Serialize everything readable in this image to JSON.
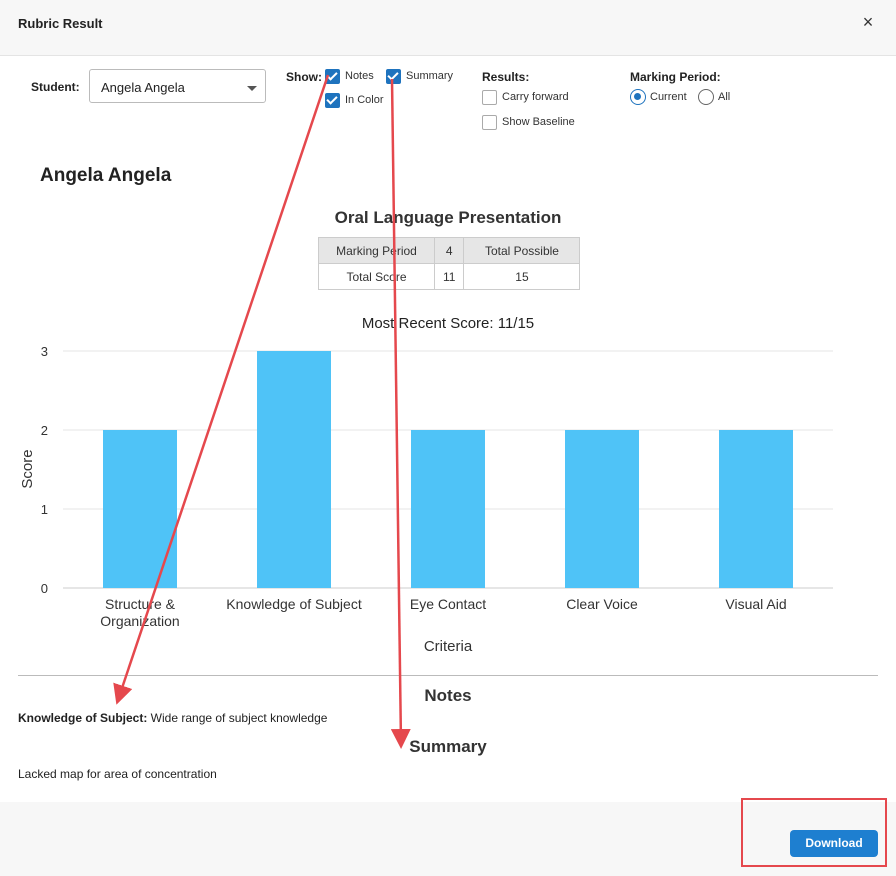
{
  "dialog": {
    "title": "Rubric Result",
    "close_label": "×"
  },
  "filters": {
    "student_label": "Student:",
    "student_value": "Angela Angela",
    "show_label": "Show:",
    "show_options": [
      {
        "label": "Notes",
        "checked": true
      },
      {
        "label": "Summary",
        "checked": true
      },
      {
        "label": "In Color",
        "checked": true
      }
    ],
    "results_label": "Results:",
    "results_options": [
      {
        "label": "Carry forward",
        "checked": false
      },
      {
        "label": "Show Baseline",
        "checked": false
      }
    ],
    "marking_period_label": "Marking Period:",
    "marking_period_options": [
      {
        "label": "Current",
        "selected": true
      },
      {
        "label": "All",
        "selected": false
      }
    ]
  },
  "report": {
    "student_name": "Angela Angela",
    "rubric_title": "Oral Language Presentation",
    "table": {
      "row1": [
        "Marking Period",
        "4",
        "Total Possible"
      ],
      "row2": [
        "Total Score",
        "11",
        "15"
      ]
    }
  },
  "chart_data": {
    "type": "bar",
    "title": "Most Recent Score: 11/15",
    "categories": [
      "Structure & Organization",
      "Knowledge of Subject",
      "Eye Contact",
      "Clear Voice",
      "Visual Aid"
    ],
    "category_lines": [
      [
        "Structure &",
        "Organization"
      ],
      [
        "Knowledge of Subject"
      ],
      [
        "Eye Contact"
      ],
      [
        "Clear Voice"
      ],
      [
        "Visual Aid"
      ]
    ],
    "values": [
      2,
      3,
      2,
      2,
      2
    ],
    "xlabel": "Criteria",
    "ylabel": "Score",
    "ylim": [
      0,
      3
    ],
    "yticks": [
      "0",
      "1",
      "2",
      "3"
    ],
    "grid": true,
    "bar_color": "#4fc3f7"
  },
  "notes": {
    "title": "Notes",
    "items": [
      {
        "criterion": "Knowledge of Subject:",
        "text": " Wide range of subject knowledge"
      }
    ]
  },
  "summary": {
    "title": "Summary",
    "text": "Lacked map for area of concentration"
  },
  "footer": {
    "download_label": "Download"
  },
  "colors": {
    "accent": "#1e73be",
    "annotation": "#e5484d"
  }
}
